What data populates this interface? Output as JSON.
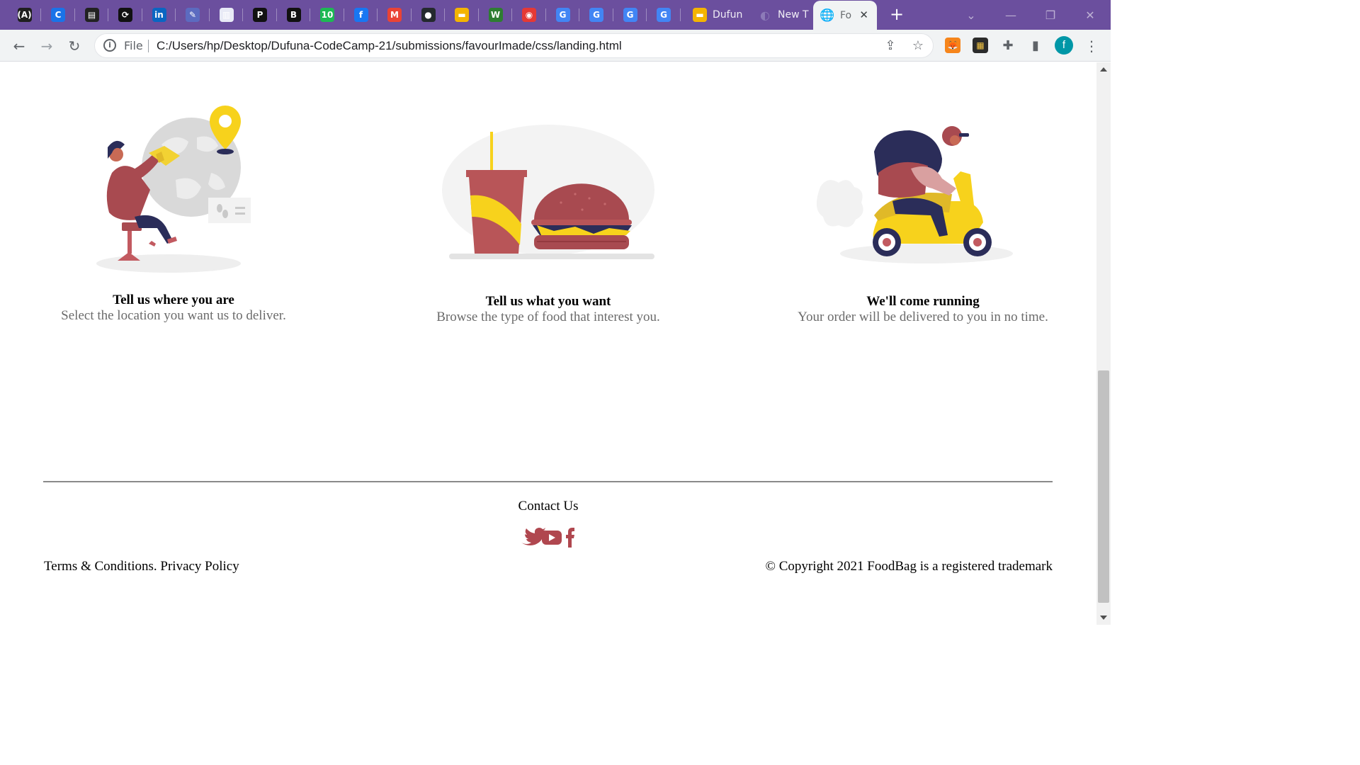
{
  "browser": {
    "pinned_tabs": [
      {
        "icon": "a-bracket-icon",
        "glyph": "(A)",
        "color": "#1f1f1f"
      },
      {
        "icon": "c-icon",
        "glyph": "C",
        "color": "#1a73e8"
      },
      {
        "icon": "book-icon",
        "glyph": "▤",
        "color": "#222222"
      },
      {
        "icon": "link-icon",
        "glyph": "⟳",
        "color": "#111111"
      },
      {
        "icon": "linkedin-icon",
        "glyph": "in",
        "color": "#0a66c2"
      },
      {
        "icon": "pen-icon",
        "glyph": "✎",
        "color": "#5c6bc0"
      },
      {
        "icon": "doc-icon",
        "glyph": "▥",
        "color": "#e8eaf6"
      },
      {
        "icon": "p-icon",
        "glyph": "P",
        "color": "#111111"
      },
      {
        "icon": "b-icon",
        "glyph": "B",
        "color": "#111111"
      },
      {
        "icon": "counter-icon",
        "glyph": "10",
        "color": "#1db954"
      },
      {
        "icon": "facebook-icon",
        "glyph": "f",
        "color": "#1877f2"
      },
      {
        "icon": "gmail-icon",
        "glyph": "M",
        "color": "#ea4335"
      },
      {
        "icon": "github-icon",
        "glyph": "●",
        "color": "#24292e"
      },
      {
        "icon": "slides-icon",
        "glyph": "▬",
        "color": "#f4b400"
      },
      {
        "icon": "w-icon",
        "glyph": "W",
        "color": "#2e7d32"
      },
      {
        "icon": "record-icon",
        "glyph": "◉",
        "color": "#e53935"
      },
      {
        "icon": "google-icon",
        "glyph": "G",
        "color": "#4285f4"
      },
      {
        "icon": "google-icon",
        "glyph": "G",
        "color": "#4285f4"
      },
      {
        "icon": "google-icon",
        "glyph": "G",
        "color": "#4285f4"
      },
      {
        "icon": "google-icon",
        "glyph": "G",
        "color": "#4285f4"
      }
    ],
    "tabs": [
      {
        "title": "Dufun",
        "icon": "slides-icon"
      },
      {
        "title": "New T",
        "icon": "new-tab-icon"
      },
      {
        "title": "Fo",
        "icon": "globe-icon"
      }
    ],
    "address": {
      "scheme_label": "File",
      "url": "C:/Users/hp/Desktop/Dufuna-CodeCamp-21/submissions/favourImade/css/landing.html"
    },
    "profile_initial": "f",
    "accent_color": "#6b4f9e"
  },
  "steps": [
    {
      "title": "Tell us where you are",
      "description": "Select the location you want us to deliver."
    },
    {
      "title": "Tell us what you want",
      "description": "Browse the type of food that interest you."
    },
    {
      "title": "We'll come running",
      "description": "Your order will be delivered to you in no time."
    }
  ],
  "footer": {
    "contact_label": "Contact Us",
    "social_icons": [
      "twitter-icon",
      "youtube-icon",
      "facebook-icon"
    ],
    "terms": "Terms & Conditions. Privacy Policy",
    "copyright": "© Copyright 2021 FoodBag is a registered trademark",
    "brand_color": "#b0474f"
  }
}
